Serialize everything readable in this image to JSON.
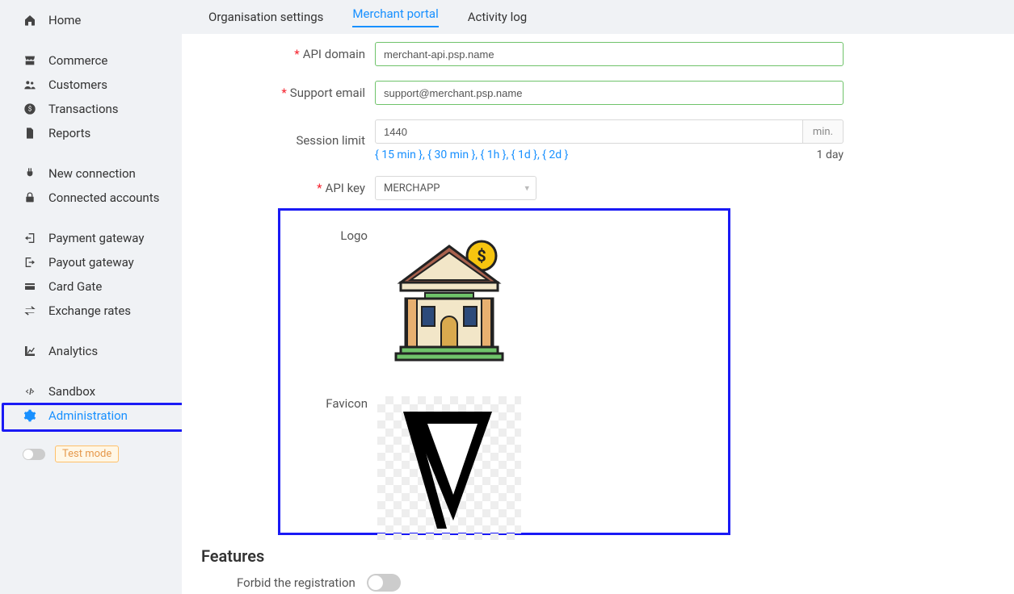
{
  "sidebar": {
    "items": [
      {
        "icon": "home-icon",
        "label": "Home"
      },
      {
        "icon": "store-icon",
        "label": "Commerce"
      },
      {
        "icon": "users-icon",
        "label": "Customers"
      },
      {
        "icon": "dollar-circle-icon",
        "label": "Transactions"
      },
      {
        "icon": "file-icon",
        "label": "Reports"
      },
      {
        "icon": "plug-icon",
        "label": "New connection"
      },
      {
        "icon": "lock-icon",
        "label": "Connected accounts"
      },
      {
        "icon": "login-icon",
        "label": "Payment gateway"
      },
      {
        "icon": "logout-icon",
        "label": "Payout gateway"
      },
      {
        "icon": "card-icon",
        "label": "Card Gate"
      },
      {
        "icon": "exchange-icon",
        "label": "Exchange rates"
      },
      {
        "icon": "chart-icon",
        "label": "Analytics"
      },
      {
        "icon": "code-icon",
        "label": "Sandbox"
      },
      {
        "icon": "gear-icon",
        "label": "Administration"
      }
    ],
    "selected_index": 13,
    "test_mode_label": "Test mode"
  },
  "tabs": {
    "items": [
      "Organisation settings",
      "Merchant portal",
      "Activity log"
    ],
    "active_index": 1
  },
  "form": {
    "api_domain": {
      "label": "API domain",
      "value": "merchant-api.psp.name",
      "required": true
    },
    "support_email": {
      "label": "Support email",
      "value": "support@merchant.psp.name",
      "required": true
    },
    "session_limit": {
      "label": "Session limit",
      "value": "1440",
      "addon": "min.",
      "required": false
    },
    "session_presets": {
      "links": "{ 15 min }, { 30 min }, { 1h }, { 1d }, { 2d }",
      "current": "1 day"
    },
    "api_key": {
      "label": "API key",
      "value": "MERCHAPP",
      "required": true
    },
    "logo_label": "Logo",
    "favicon_label": "Favicon"
  },
  "features": {
    "heading": "Features",
    "forbid_registration_label": "Forbid the registration",
    "forbid_registration_on": false
  }
}
